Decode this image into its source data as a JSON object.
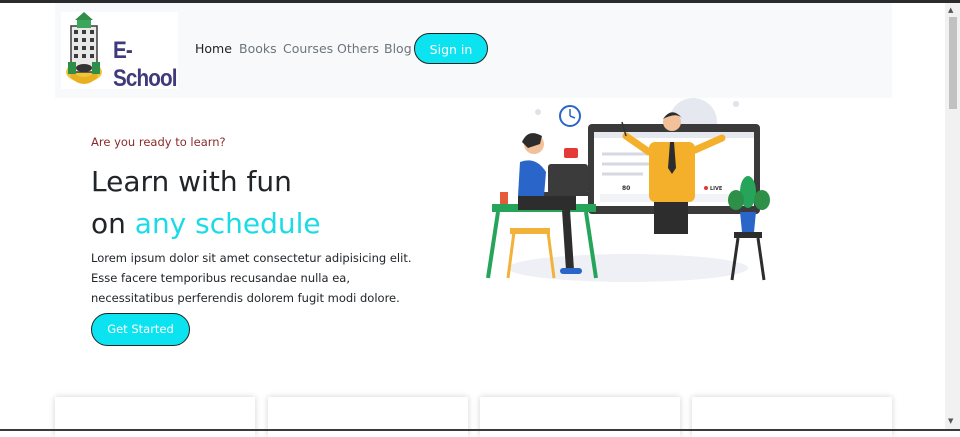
{
  "brand": {
    "name": "E- School"
  },
  "nav": {
    "links": [
      "Home",
      "Books",
      "Courses",
      "Others",
      "Blog"
    ],
    "active": "Home",
    "signin_label": "Sign in"
  },
  "hero": {
    "eyebrow": "Are you ready to learn?",
    "title_line1": "Learn with fun",
    "title_line2_prefix": "on ",
    "title_line2_accent": "any schedule",
    "description": "Lorem ipsum dolor sit amet consectetur adipisicing elit. Esse facere temporibus recusandae nulla ea, necessitatibus perferendis dolorem fugit modi dolore.",
    "cta_label": "Get Started"
  },
  "illustration": {
    "live_count": "80",
    "live_label": "LIVE"
  },
  "colors": {
    "accent": "#0ce3f0",
    "navbar_bg": "#f8f9fa",
    "eyebrow": "#8b2a2a"
  }
}
